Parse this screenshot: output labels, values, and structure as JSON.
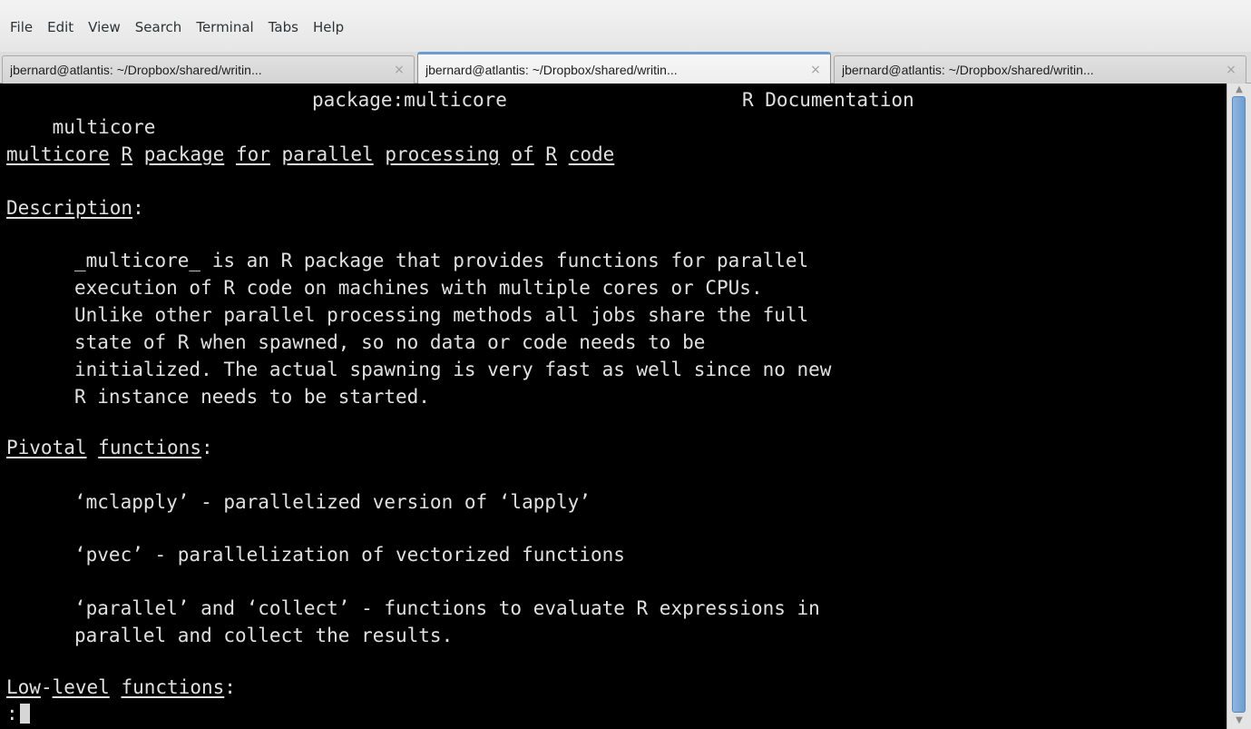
{
  "menubar": {
    "items": [
      "File",
      "Edit",
      "View",
      "Search",
      "Terminal",
      "Tabs",
      "Help"
    ]
  },
  "tabs": [
    {
      "label": "jbernard@atlantis: ~/Dropbox/shared/writin...",
      "close": "×",
      "active": false
    },
    {
      "label": "jbernard@atlantis: ~/Dropbox/shared/writin...",
      "close": "×",
      "active": true
    },
    {
      "label": "jbernard@atlantis: ~/Dropbox/shared/writin...",
      "close": "×",
      "active": false
    }
  ],
  "terminal": {
    "header": {
      "name": "multicore",
      "package": "package:multicore",
      "doc": "R Documentation"
    },
    "title_words": [
      "multicore",
      "R",
      "package",
      "for",
      "parallel",
      "processing",
      "of",
      "R",
      "code"
    ],
    "description_heading": "Description",
    "description_lines": [
      "_multicore_ is an R package that provides functions for parallel",
      "execution of R code on machines with multiple cores or CPUs.",
      "Unlike other parallel processing methods all jobs share the full",
      "state of R when spawned, so no data or code needs to be",
      "initialized. The actual spawning is very fast as well since no new",
      "R instance needs to be started."
    ],
    "pivotal_heading_words": [
      "Pivotal",
      "functions"
    ],
    "pivotal_lines": [
      "‘mclapply’ - parallelized version of ‘lapply’",
      "‘pvec’ - parallelization of vectorized functions",
      "‘parallel’ and ‘collect’ - functions to evaluate R expressions in",
      "parallel and collect the results."
    ],
    "lowlevel_heading_parts": [
      "Low",
      "-",
      "level",
      "functions"
    ],
    "prompt": ":",
    "colon": ":"
  },
  "colors": {
    "terminal_bg": "#000000",
    "terminal_fg": "#e0e0e0",
    "tab_accent": "#6d9bd1",
    "scroll_thumb": "#7ba6d8"
  }
}
